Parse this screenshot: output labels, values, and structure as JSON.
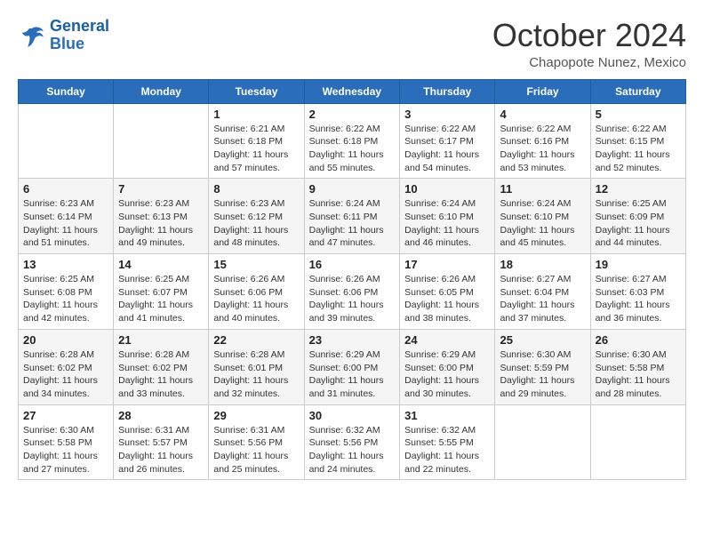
{
  "header": {
    "logo_line1": "General",
    "logo_line2": "Blue",
    "month": "October 2024",
    "location": "Chapopote Nunez, Mexico"
  },
  "weekdays": [
    "Sunday",
    "Monday",
    "Tuesday",
    "Wednesday",
    "Thursday",
    "Friday",
    "Saturday"
  ],
  "weeks": [
    [
      {
        "day": "",
        "info": ""
      },
      {
        "day": "",
        "info": ""
      },
      {
        "day": "1",
        "info": "Sunrise: 6:21 AM\nSunset: 6:18 PM\nDaylight: 11 hours and 57 minutes."
      },
      {
        "day": "2",
        "info": "Sunrise: 6:22 AM\nSunset: 6:18 PM\nDaylight: 11 hours and 55 minutes."
      },
      {
        "day": "3",
        "info": "Sunrise: 6:22 AM\nSunset: 6:17 PM\nDaylight: 11 hours and 54 minutes."
      },
      {
        "day": "4",
        "info": "Sunrise: 6:22 AM\nSunset: 6:16 PM\nDaylight: 11 hours and 53 minutes."
      },
      {
        "day": "5",
        "info": "Sunrise: 6:22 AM\nSunset: 6:15 PM\nDaylight: 11 hours and 52 minutes."
      }
    ],
    [
      {
        "day": "6",
        "info": "Sunrise: 6:23 AM\nSunset: 6:14 PM\nDaylight: 11 hours and 51 minutes."
      },
      {
        "day": "7",
        "info": "Sunrise: 6:23 AM\nSunset: 6:13 PM\nDaylight: 11 hours and 49 minutes."
      },
      {
        "day": "8",
        "info": "Sunrise: 6:23 AM\nSunset: 6:12 PM\nDaylight: 11 hours and 48 minutes."
      },
      {
        "day": "9",
        "info": "Sunrise: 6:24 AM\nSunset: 6:11 PM\nDaylight: 11 hours and 47 minutes."
      },
      {
        "day": "10",
        "info": "Sunrise: 6:24 AM\nSunset: 6:10 PM\nDaylight: 11 hours and 46 minutes."
      },
      {
        "day": "11",
        "info": "Sunrise: 6:24 AM\nSunset: 6:10 PM\nDaylight: 11 hours and 45 minutes."
      },
      {
        "day": "12",
        "info": "Sunrise: 6:25 AM\nSunset: 6:09 PM\nDaylight: 11 hours and 44 minutes."
      }
    ],
    [
      {
        "day": "13",
        "info": "Sunrise: 6:25 AM\nSunset: 6:08 PM\nDaylight: 11 hours and 42 minutes."
      },
      {
        "day": "14",
        "info": "Sunrise: 6:25 AM\nSunset: 6:07 PM\nDaylight: 11 hours and 41 minutes."
      },
      {
        "day": "15",
        "info": "Sunrise: 6:26 AM\nSunset: 6:06 PM\nDaylight: 11 hours and 40 minutes."
      },
      {
        "day": "16",
        "info": "Sunrise: 6:26 AM\nSunset: 6:06 PM\nDaylight: 11 hours and 39 minutes."
      },
      {
        "day": "17",
        "info": "Sunrise: 6:26 AM\nSunset: 6:05 PM\nDaylight: 11 hours and 38 minutes."
      },
      {
        "day": "18",
        "info": "Sunrise: 6:27 AM\nSunset: 6:04 PM\nDaylight: 11 hours and 37 minutes."
      },
      {
        "day": "19",
        "info": "Sunrise: 6:27 AM\nSunset: 6:03 PM\nDaylight: 11 hours and 36 minutes."
      }
    ],
    [
      {
        "day": "20",
        "info": "Sunrise: 6:28 AM\nSunset: 6:02 PM\nDaylight: 11 hours and 34 minutes."
      },
      {
        "day": "21",
        "info": "Sunrise: 6:28 AM\nSunset: 6:02 PM\nDaylight: 11 hours and 33 minutes."
      },
      {
        "day": "22",
        "info": "Sunrise: 6:28 AM\nSunset: 6:01 PM\nDaylight: 11 hours and 32 minutes."
      },
      {
        "day": "23",
        "info": "Sunrise: 6:29 AM\nSunset: 6:00 PM\nDaylight: 11 hours and 31 minutes."
      },
      {
        "day": "24",
        "info": "Sunrise: 6:29 AM\nSunset: 6:00 PM\nDaylight: 11 hours and 30 minutes."
      },
      {
        "day": "25",
        "info": "Sunrise: 6:30 AM\nSunset: 5:59 PM\nDaylight: 11 hours and 29 minutes."
      },
      {
        "day": "26",
        "info": "Sunrise: 6:30 AM\nSunset: 5:58 PM\nDaylight: 11 hours and 28 minutes."
      }
    ],
    [
      {
        "day": "27",
        "info": "Sunrise: 6:30 AM\nSunset: 5:58 PM\nDaylight: 11 hours and 27 minutes."
      },
      {
        "day": "28",
        "info": "Sunrise: 6:31 AM\nSunset: 5:57 PM\nDaylight: 11 hours and 26 minutes."
      },
      {
        "day": "29",
        "info": "Sunrise: 6:31 AM\nSunset: 5:56 PM\nDaylight: 11 hours and 25 minutes."
      },
      {
        "day": "30",
        "info": "Sunrise: 6:32 AM\nSunset: 5:56 PM\nDaylight: 11 hours and 24 minutes."
      },
      {
        "day": "31",
        "info": "Sunrise: 6:32 AM\nSunset: 5:55 PM\nDaylight: 11 hours and 22 minutes."
      },
      {
        "day": "",
        "info": ""
      },
      {
        "day": "",
        "info": ""
      }
    ]
  ]
}
